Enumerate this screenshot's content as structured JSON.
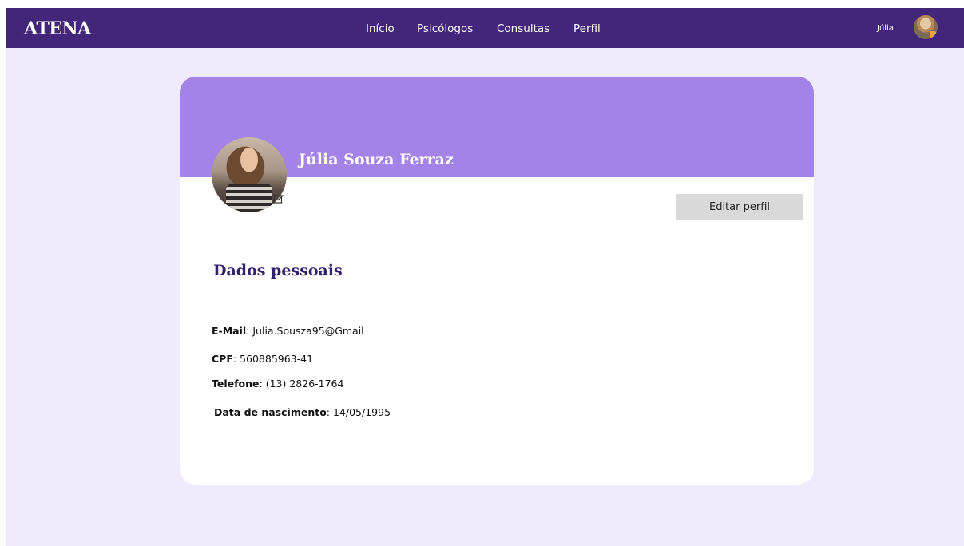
{
  "brand": {
    "logo": "ATENA"
  },
  "nav": {
    "items": [
      "Início",
      "Psicólogos",
      "Consultas",
      "Perfil"
    ]
  },
  "user": {
    "name": "Júlia"
  },
  "profile": {
    "full_name": "Júlia Souza Ferraz",
    "edit_button_label": "Editar perfil",
    "section_title": "Dados pessoais",
    "fields": [
      {
        "label": "E-Mail",
        "value": ": Julia.Sousza95@Gmail"
      },
      {
        "label": "CPF",
        "value": ": 560885963-41"
      },
      {
        "label": "Telefone",
        "value": ": (13) 2826-1764"
      },
      {
        "label": "Data de nascimento",
        "value": ": 14/05/1995"
      }
    ]
  },
  "colors": {
    "topbar": "#43257a",
    "banner": "#a383e8",
    "page_background": "#efebfd",
    "section_title": "#34206a"
  },
  "icons": {
    "edit_photo": "edit-icon"
  }
}
